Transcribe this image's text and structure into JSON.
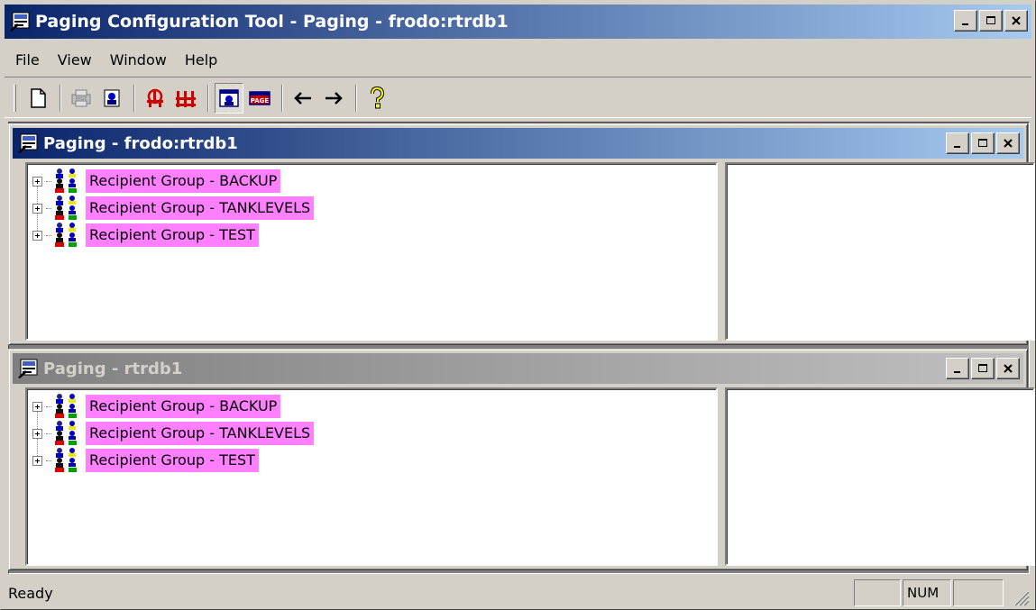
{
  "app": {
    "title": "Paging Configuration Tool - Paging - frodo:rtrdb1",
    "icon": "paging-app-icon"
  },
  "menubar": {
    "items": [
      "File",
      "View",
      "Window",
      "Help"
    ]
  },
  "toolbar": {
    "buttons": [
      {
        "icon": "new-document-icon"
      },
      {
        "icon": "page-printer-icon"
      },
      {
        "icon": "recipient-icon"
      },
      {
        "icon": "group-red-icon"
      },
      {
        "icon": "group-schedule-icon"
      },
      {
        "icon": "view-recipient-icon",
        "pressed": true
      },
      {
        "icon": "page-icon"
      },
      {
        "icon": "arrow-left-icon"
      },
      {
        "icon": "arrow-right-icon"
      },
      {
        "icon": "help-icon"
      }
    ]
  },
  "windows": [
    {
      "title": "Paging - frodo:rtrdb1",
      "active": true,
      "items": [
        "Recipient Group - BACKUP",
        "Recipient Group - TANKLEVELS",
        "Recipient Group - TEST"
      ]
    },
    {
      "title": "Paging - rtrdb1",
      "active": false,
      "items": [
        "Recipient Group - BACKUP",
        "Recipient Group - TANKLEVELS",
        "Recipient Group - TEST"
      ]
    }
  ],
  "statusbar": {
    "text": "Ready",
    "panels": [
      "",
      "NUM",
      ""
    ]
  },
  "colors": {
    "active_title": "#0a246a",
    "inactive_title": "#808080",
    "highlight": "#ff80ff",
    "face": "#d4d0c8"
  }
}
